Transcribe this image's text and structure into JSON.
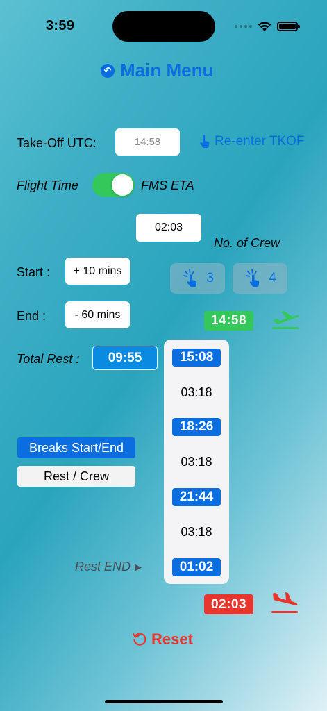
{
  "status_bar": {
    "time": "3:59"
  },
  "header": {
    "main_menu_label": "Main Menu"
  },
  "takeoff": {
    "label": "Take-Off UTC:",
    "value": "14:58",
    "reenter_label": "Re-enter TKOF"
  },
  "mode": {
    "left_label": "Flight Time",
    "right_label": "FMS ETA",
    "toggle_on": true
  },
  "eta": {
    "value": "02:03"
  },
  "crew": {
    "label": "No. of Crew",
    "option_3": "3",
    "option_4": "4"
  },
  "start": {
    "label": "Start :",
    "value": "+ 10 mins"
  },
  "end": {
    "label": "End :",
    "value": "- 60 mins"
  },
  "takeoff_badge": "14:58",
  "landing_badge": "02:03",
  "total_rest": {
    "label": "Total Rest :",
    "value": "09:55"
  },
  "schedule": [
    "15:08",
    "03:18",
    "18:26",
    "03:18",
    "21:44",
    "03:18",
    "01:02"
  ],
  "buttons": {
    "breaks": "Breaks Start/End",
    "rest_crew": "Rest / Crew",
    "reset": "Reset"
  },
  "rest_end_label": "Rest END",
  "colors": {
    "accent_blue": "#0a6ee0",
    "green": "#34c759",
    "red": "#e8362e"
  }
}
